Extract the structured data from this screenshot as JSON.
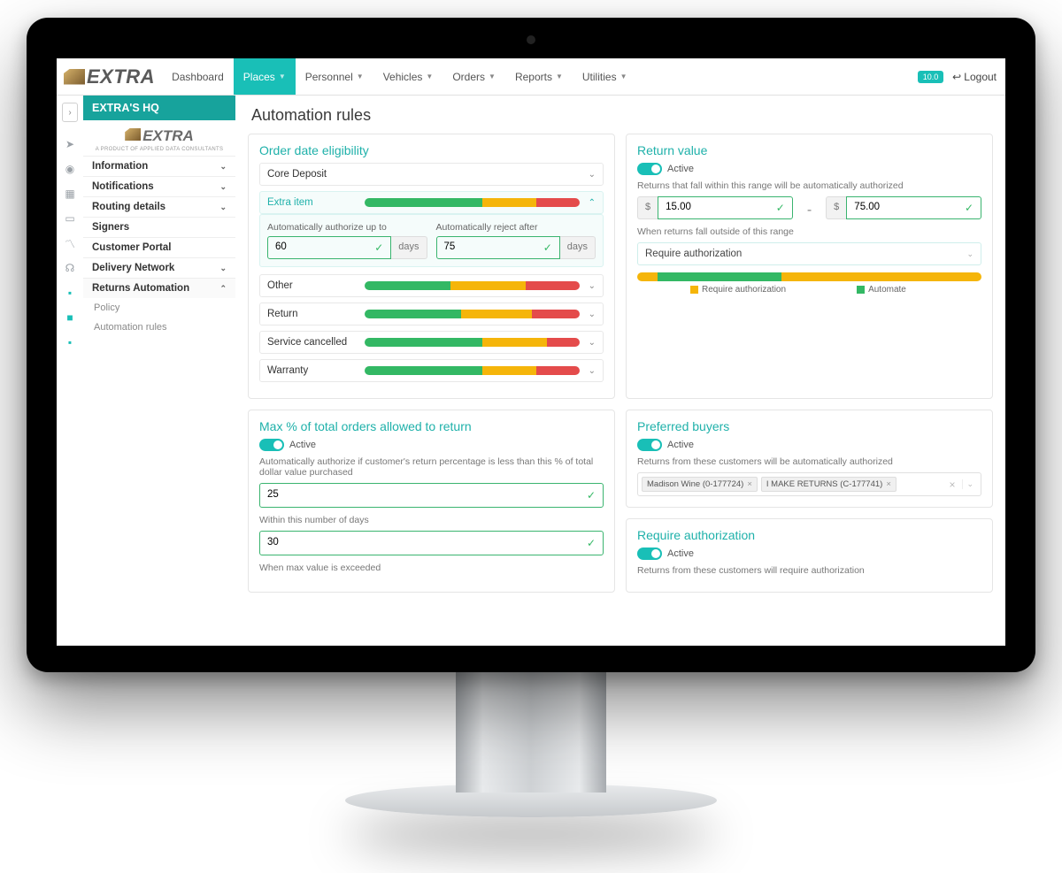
{
  "brand": "EXTRA",
  "brand_tagline": "A PRODUCT OF APPLIED DATA CONSULTANTS",
  "nav": {
    "items": [
      "Dashboard",
      "Places",
      "Personnel",
      "Vehicles",
      "Orders",
      "Reports",
      "Utilities"
    ],
    "active_index": 1,
    "version": "10.0",
    "logout": "Logout"
  },
  "sidebar": {
    "header": "EXTRA'S HQ",
    "items": [
      {
        "label": "Information",
        "chev": true
      },
      {
        "label": "Notifications",
        "chev": true
      },
      {
        "label": "Routing details",
        "chev": true
      },
      {
        "label": "Signers",
        "chev": false
      },
      {
        "label": "Customer Portal",
        "chev": false
      },
      {
        "label": "Delivery Network",
        "chev": true
      },
      {
        "label": "Returns Automation",
        "chev": true,
        "expanded": true
      }
    ],
    "sub": [
      "Policy",
      "Automation rules"
    ]
  },
  "page": {
    "title": "Automation rules"
  },
  "orderDate": {
    "title": "Order date eligibility",
    "rows": [
      {
        "label": "Core Deposit",
        "bars": null
      },
      {
        "label": "Extra item",
        "bars": [
          55,
          25,
          20
        ],
        "open": true
      },
      {
        "label": "Other",
        "bars": [
          40,
          35,
          25
        ]
      },
      {
        "label": "Return",
        "bars": [
          45,
          33,
          22
        ]
      },
      {
        "label": "Service cancelled",
        "bars": [
          55,
          30,
          15
        ]
      },
      {
        "label": "Warranty",
        "bars": [
          55,
          25,
          20
        ]
      }
    ],
    "openFields": {
      "authLabel": "Automatically authorize up to",
      "authVal": "60",
      "rejectLabel": "Automatically reject after",
      "rejectVal": "75",
      "unit": "days"
    }
  },
  "returnValue": {
    "title": "Return value",
    "active": "Active",
    "desc": "Returns that fall within this range will be automatically authorized",
    "currency": "$",
    "min": "15.00",
    "max": "75.00",
    "outsideLabel": "When returns fall outside of this range",
    "outsideSelected": "Require authorization",
    "legend": {
      "a": "Require authorization",
      "b": "Automate"
    },
    "bars": [
      6,
      36,
      58
    ]
  },
  "maxPct": {
    "title": "Max % of total orders allowed to return",
    "active": "Active",
    "desc": "Automatically authorize if customer's return percentage is less than this % of total dollar value purchased",
    "val": "25",
    "daysLabel": "Within this number of days",
    "daysVal": "30",
    "exceed": "When max value is exceeded"
  },
  "buyers": {
    "title": "Preferred buyers",
    "active": "Active",
    "desc": "Returns from these customers will be automatically authorized",
    "tags": [
      "Madison Wine (0-177724)",
      "I MAKE RETURNS (C-177741)"
    ]
  },
  "reqAuth": {
    "title": "Require authorization",
    "active": "Active",
    "desc": "Returns from these customers will require authorization"
  }
}
